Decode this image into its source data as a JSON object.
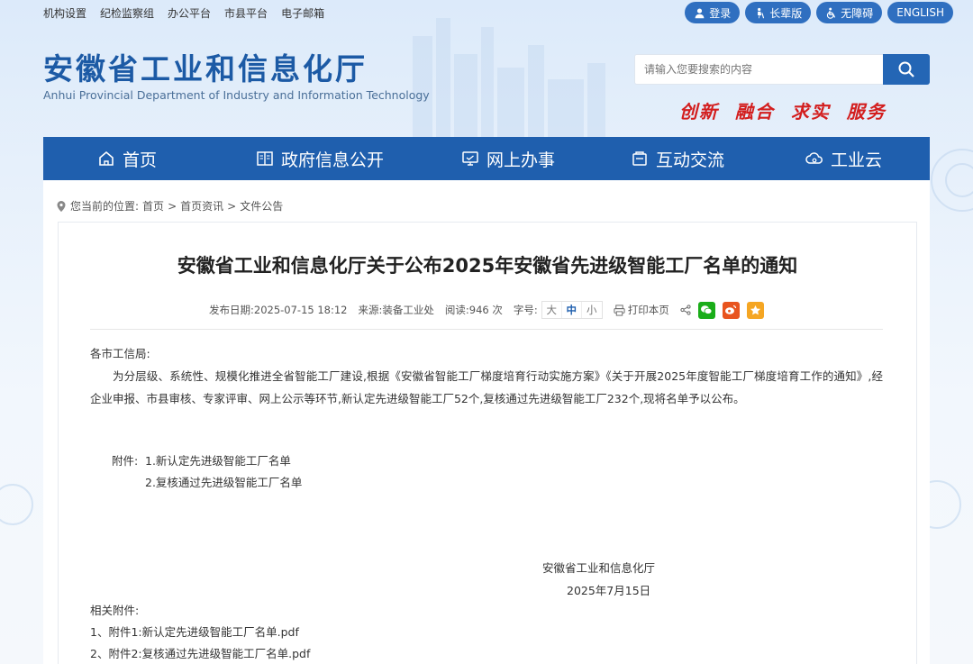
{
  "top_links": [
    "机构设置",
    "纪检监察组",
    "办公平台",
    "市县平台",
    "电子邮箱"
  ],
  "top_buttons": {
    "login": "登录",
    "elder": "长辈版",
    "accessible": "无障碍",
    "english": "ENGLISH"
  },
  "logo": {
    "cn": "安徽省工业和信息化厅",
    "en": "Anhui Provincial Department of Industry and Information Technology"
  },
  "search": {
    "placeholder": "请输入您要搜索的内容"
  },
  "slogan": "创新  融合  求实  服务",
  "nav": [
    "首页",
    "政府信息公开",
    "网上办事",
    "互动交流",
    "工业云"
  ],
  "breadcrumb": {
    "label": "您当前的位置:",
    "items": [
      "首页",
      "首页资讯",
      "文件公告"
    ],
    "sep": ">"
  },
  "article": {
    "title": "安徽省工业和信息化厅关于公布2025年安徽省先进级智能工厂名单的通知",
    "meta": {
      "date": "发布日期:2025-07-15 18:12",
      "source": "来源:装备工业处",
      "views": "阅读:946 次",
      "fontsize_label": "字号:",
      "sizes": [
        "大",
        "中",
        "小"
      ],
      "print": "打印本页"
    },
    "salutation": "各市工信局:",
    "paragraph": "为分层级、系统性、规模化推进全省智能工厂建设,根据《安徽省智能工厂梯度培育行动实施方案》《关于开展2025年度智能工厂梯度培育工作的通知》,经企业申报、市县审核、专家评审、网上公示等环节,新认定先进级智能工厂52个,复核通过先进级智能工厂232个,现将名单予以公布。",
    "attachment_label": "附件:",
    "attachments": [
      "1.新认定先进级智能工厂名单",
      "2.复核通过先进级智能工厂名单"
    ],
    "signature": "安徽省工业和信息化厅",
    "sign_date": "2025年7月15日",
    "related_label": "相关附件:",
    "related": [
      "1、附件1:新认定先进级智能工厂名单.pdf",
      "2、附件2:复核通过先进级智能工厂名单.pdf"
    ]
  },
  "colors": {
    "brand": "#1f5fae",
    "slogan": "#d31e1e",
    "wechat": "#1aad19",
    "weibo": "#e8541e",
    "favorite": "#f5a623"
  }
}
